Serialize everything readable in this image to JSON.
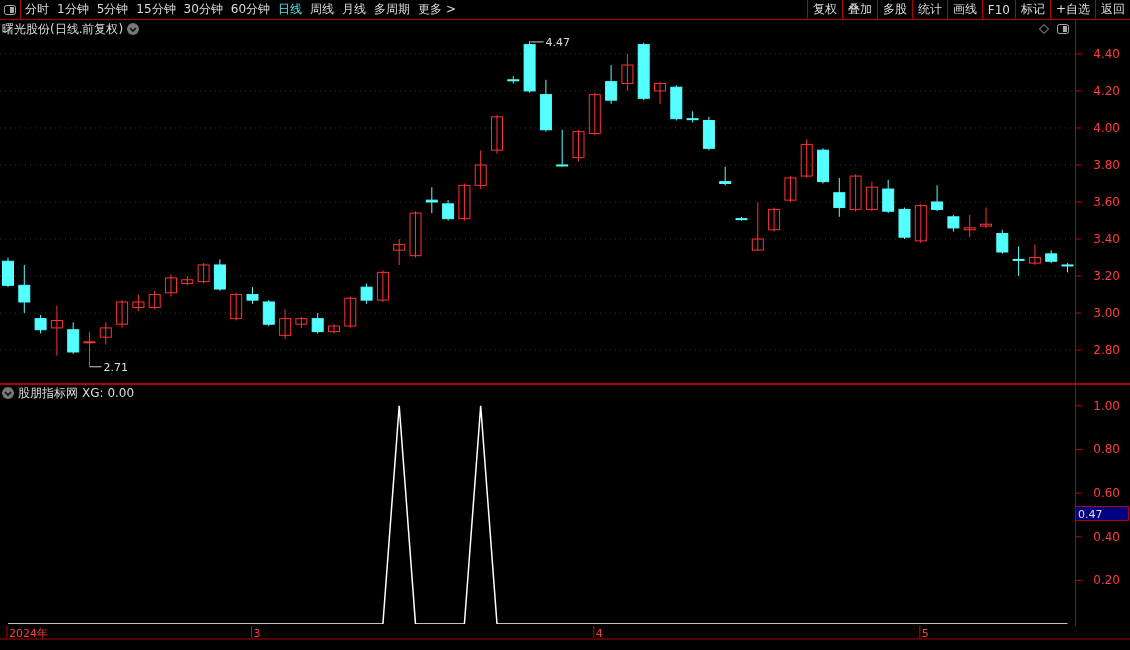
{
  "toolbar": {
    "periods": [
      {
        "label": "分时",
        "selected": false
      },
      {
        "label": "1分钟",
        "selected": false
      },
      {
        "label": "5分钟",
        "selected": false
      },
      {
        "label": "15分钟",
        "selected": false
      },
      {
        "label": "30分钟",
        "selected": false
      },
      {
        "label": "60分钟",
        "selected": false
      },
      {
        "label": "日线",
        "selected": true
      },
      {
        "label": "周线",
        "selected": false
      },
      {
        "label": "月线",
        "selected": false
      },
      {
        "label": "多周期",
        "selected": false
      },
      {
        "label": "更多 >",
        "selected": false
      }
    ],
    "buttons": [
      "复权",
      "叠加",
      "多股",
      "统计",
      "画线",
      "F10",
      "标记",
      "+自选",
      "返回"
    ]
  },
  "price_chart": {
    "title": "曙光股份(日线.前复权)",
    "high_label": "4.47",
    "low_label": "2.71",
    "chart_data": {
      "type": "candlestick",
      "ylim": [
        2.617,
        4.583
      ],
      "grid": true,
      "yticks": [
        {
          "value": 4.4,
          "label": "4.40"
        },
        {
          "value": 4.2,
          "label": "4.20"
        },
        {
          "value": 4.0,
          "label": "4.00"
        },
        {
          "value": 3.8,
          "label": "3.80"
        },
        {
          "value": 3.6,
          "label": "3.60"
        },
        {
          "value": 3.4,
          "label": "3.40"
        },
        {
          "value": 3.2,
          "label": "3.20"
        },
        {
          "value": 3.0,
          "label": "3.00"
        },
        {
          "value": 2.8,
          "label": "2.80"
        }
      ],
      "ohlc": [
        [
          3.28,
          3.3,
          3.14,
          3.15
        ],
        [
          3.15,
          3.26,
          3.0,
          3.06
        ],
        [
          2.97,
          2.99,
          2.89,
          2.91
        ],
        [
          2.92,
          3.04,
          2.77,
          2.96
        ],
        [
          2.91,
          2.95,
          2.78,
          2.79
        ],
        [
          2.84,
          2.9,
          2.71,
          2.845
        ],
        [
          2.87,
          2.95,
          2.83,
          2.92
        ],
        [
          2.94,
          3.07,
          2.92,
          3.06
        ],
        [
          3.03,
          3.1,
          3.01,
          3.06
        ],
        [
          3.03,
          3.12,
          3.02,
          3.1
        ],
        [
          3.11,
          3.21,
          3.09,
          3.19
        ],
        [
          3.16,
          3.2,
          3.15,
          3.18
        ],
        [
          3.17,
          3.27,
          3.16,
          3.26
        ],
        [
          3.26,
          3.29,
          3.12,
          3.13
        ],
        [
          2.97,
          3.11,
          2.96,
          3.1
        ],
        [
          3.1,
          3.14,
          3.05,
          3.07
        ],
        [
          3.06,
          3.07,
          2.93,
          2.94
        ],
        [
          2.88,
          3.02,
          2.86,
          2.97
        ],
        [
          2.94,
          2.98,
          2.92,
          2.97
        ],
        [
          2.97,
          3.0,
          2.89,
          2.9
        ],
        [
          2.9,
          2.94,
          2.89,
          2.93
        ],
        [
          2.93,
          3.09,
          2.92,
          3.08
        ],
        [
          3.14,
          3.16,
          3.05,
          3.07
        ],
        [
          3.07,
          3.23,
          3.06,
          3.22
        ],
        [
          3.34,
          3.4,
          3.26,
          3.37
        ],
        [
          3.31,
          3.55,
          3.3,
          3.54
        ],
        [
          3.61,
          3.68,
          3.54,
          3.6
        ],
        [
          3.59,
          3.61,
          3.5,
          3.51
        ],
        [
          3.51,
          3.7,
          3.5,
          3.69
        ],
        [
          3.69,
          3.88,
          3.67,
          3.8
        ],
        [
          3.88,
          4.07,
          3.86,
          4.06
        ],
        [
          4.26,
          4.28,
          4.24,
          4.255
        ],
        [
          4.45,
          4.47,
          4.19,
          4.2
        ],
        [
          4.18,
          4.26,
          3.98,
          3.99
        ],
        [
          3.8,
          3.99,
          3.79,
          3.795
        ],
        [
          3.84,
          3.99,
          3.82,
          3.98
        ],
        [
          3.97,
          4.19,
          3.96,
          4.18
        ],
        [
          4.25,
          4.34,
          4.13,
          4.15
        ],
        [
          4.24,
          4.4,
          4.2,
          4.34
        ],
        [
          4.45,
          4.46,
          4.15,
          4.16
        ],
        [
          4.2,
          4.25,
          4.13,
          4.24
        ],
        [
          4.22,
          4.23,
          4.04,
          4.05
        ],
        [
          4.05,
          4.09,
          4.03,
          4.045
        ],
        [
          4.04,
          4.06,
          3.88,
          3.89
        ],
        [
          3.71,
          3.79,
          3.69,
          3.7
        ],
        [
          3.51,
          3.52,
          3.5,
          3.505
        ],
        [
          3.34,
          3.6,
          3.34,
          3.4
        ],
        [
          3.45,
          3.57,
          3.44,
          3.56
        ],
        [
          3.61,
          3.74,
          3.6,
          3.73
        ],
        [
          3.74,
          3.94,
          3.73,
          3.91
        ],
        [
          3.88,
          3.89,
          3.7,
          3.71
        ],
        [
          3.65,
          3.73,
          3.52,
          3.57
        ],
        [
          3.56,
          3.75,
          3.55,
          3.74
        ],
        [
          3.56,
          3.71,
          3.55,
          3.68
        ],
        [
          3.67,
          3.72,
          3.54,
          3.55
        ],
        [
          3.56,
          3.57,
          3.4,
          3.41
        ],
        [
          3.39,
          3.59,
          3.38,
          3.58
        ],
        [
          3.6,
          3.69,
          3.55,
          3.56
        ],
        [
          3.52,
          3.53,
          3.44,
          3.46
        ],
        [
          3.45,
          3.53,
          3.41,
          3.46
        ],
        [
          3.47,
          3.57,
          3.46,
          3.48
        ],
        [
          3.43,
          3.45,
          3.32,
          3.33
        ],
        [
          3.29,
          3.36,
          3.2,
          3.285
        ],
        [
          3.27,
          3.37,
          3.26,
          3.3
        ],
        [
          3.32,
          3.34,
          3.27,
          3.28
        ],
        [
          3.26,
          3.27,
          3.22,
          3.255
        ]
      ]
    }
  },
  "indicator": {
    "name": "股朋指标网",
    "readout_value": ": 0.00",
    "cursor_value": "0.47",
    "date_axis": [
      "2024年",
      "3",
      "4",
      "5"
    ],
    "chart_data": {
      "type": "line",
      "ylim": [
        0,
        1.1
      ],
      "yticks": [
        {
          "value": 1,
          "label": "1.00"
        },
        {
          "value": 0.8,
          "label": "0.80"
        },
        {
          "value": 0.6,
          "label": "0.60"
        },
        {
          "value": 0.4,
          "label": "0.40"
        },
        {
          "value": 0.2,
          "label": "0.20"
        }
      ],
      "series": [
        {
          "name": "XG",
          "color": "#ffffff",
          "values": [
            0,
            0,
            0,
            0,
            0,
            0,
            0,
            0,
            0,
            0,
            0,
            0,
            0,
            0,
            0,
            0,
            0,
            0,
            0,
            0,
            0,
            0,
            0,
            0,
            1,
            0,
            0,
            0,
            0,
            1,
            0,
            0,
            0,
            0,
            0,
            0,
            0,
            0,
            0,
            0,
            0,
            0,
            0,
            0,
            0,
            0,
            0,
            0,
            0,
            0,
            0,
            0,
            0,
            0,
            0,
            0,
            0,
            0,
            0,
            0,
            0,
            0,
            0,
            0,
            0,
            0
          ]
        }
      ]
    }
  }
}
